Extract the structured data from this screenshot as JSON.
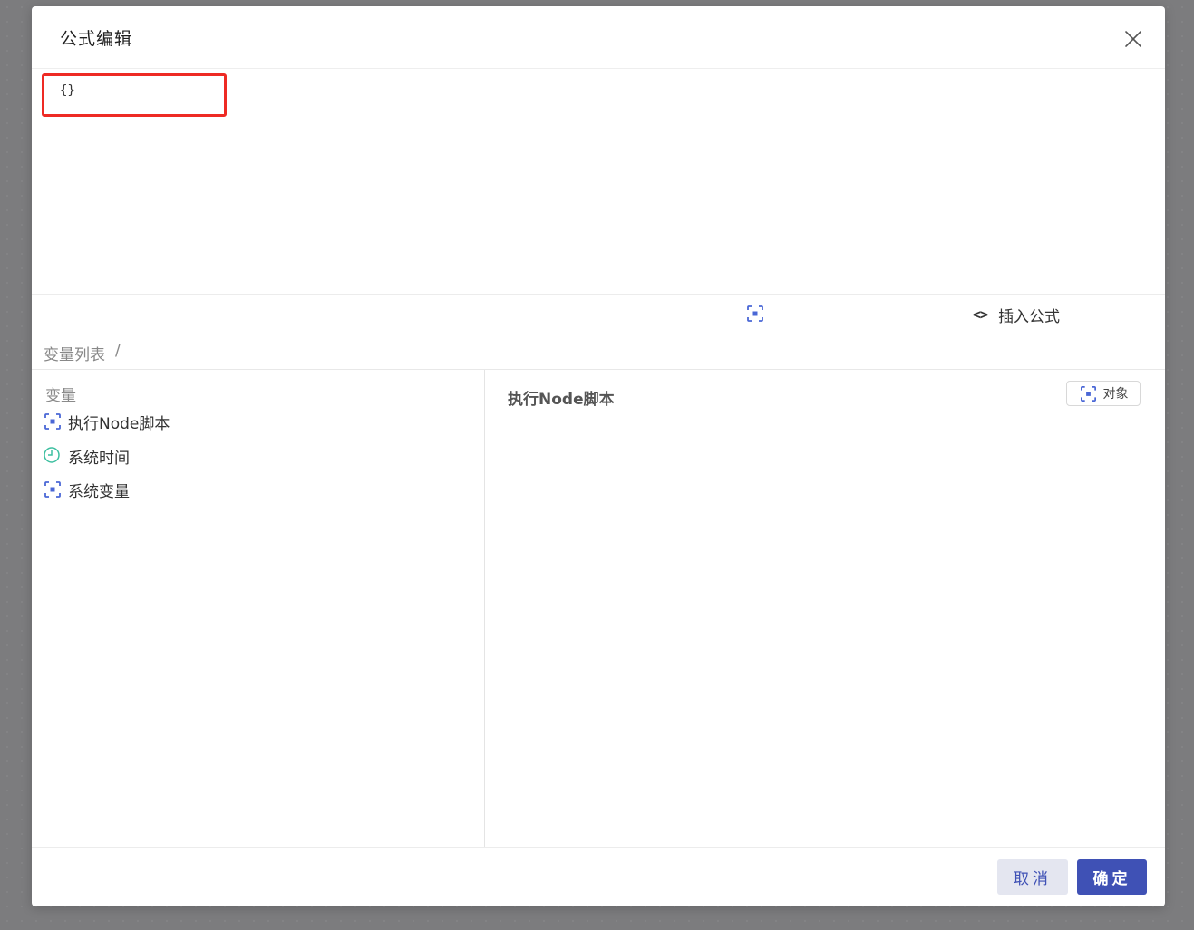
{
  "dialog": {
    "title": "公式编辑"
  },
  "editor": {
    "value": "{}"
  },
  "toolbar": {
    "object_icon": "object-bracket-icon",
    "insert_icon": "code-brackets-icon",
    "insert_label": "插入公式"
  },
  "breadcrumb": {
    "root": "变量列表",
    "separator": "/"
  },
  "variables": {
    "section_title": "变量",
    "items": [
      {
        "label": "执行Node脚本",
        "icon": "object-bracket-icon",
        "icon_color": "#4a67d6"
      },
      {
        "label": "系统时间",
        "icon": "clock-icon",
        "icon_color": "#3cbfa0"
      },
      {
        "label": "系统变量",
        "icon": "object-bracket-icon",
        "icon_color": "#4a67d6"
      }
    ]
  },
  "detail": {
    "title": "执行Node脚本",
    "type_label": "对象",
    "type_icon": "object-bracket-icon"
  },
  "footer": {
    "cancel_label": "取消",
    "ok_label": "确定"
  },
  "colors": {
    "accent": "#3f51b5",
    "highlight": "#ee2a24",
    "object_icon": "#4a67d6",
    "clock_icon": "#3cbfa0"
  }
}
